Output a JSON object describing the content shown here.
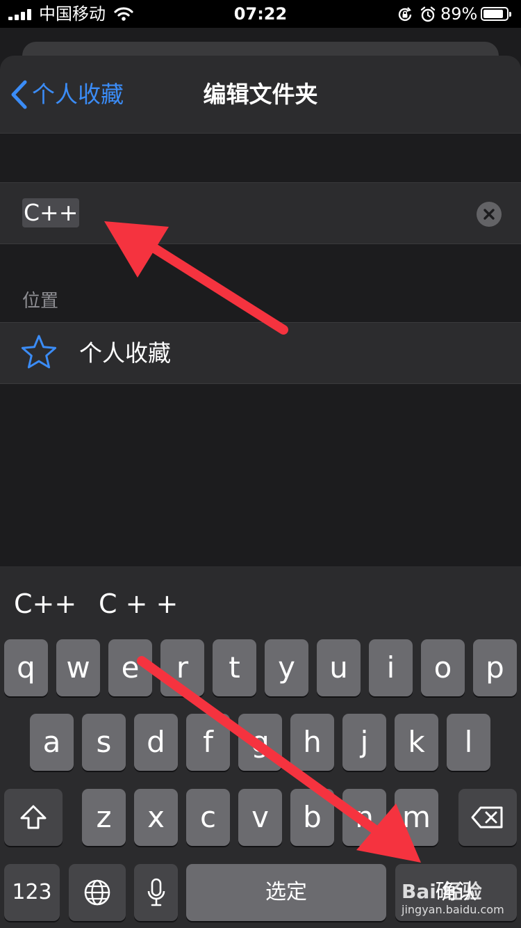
{
  "status_bar": {
    "carrier": "中国移动",
    "time": "07:22",
    "battery": "89%",
    "battery_level": 0.89
  },
  "nav": {
    "back_label": "个人收藏",
    "title": "编辑文件夹"
  },
  "form": {
    "folder_name": "C++"
  },
  "location": {
    "section_header": "位置",
    "item_label": "个人收藏"
  },
  "keyboard": {
    "suggestions": [
      "C++",
      "C + +"
    ],
    "row1": [
      "q",
      "w",
      "e",
      "r",
      "t",
      "y",
      "u",
      "i",
      "o",
      "p"
    ],
    "row2": [
      "a",
      "s",
      "d",
      "f",
      "g",
      "h",
      "j",
      "k",
      "l"
    ],
    "row3": [
      "z",
      "x",
      "c",
      "v",
      "b",
      "n",
      "m"
    ],
    "numbers_key": "123",
    "space_key": "选定",
    "confirm_key": "确认"
  },
  "watermark": {
    "logo": "Bai 经验",
    "url": "jingyan.baidu.com"
  },
  "colors": {
    "accent": "#3b8cf6",
    "annotation_arrow": "#f5333f",
    "background": "#1c1c1e",
    "row_background": "#2c2c2e",
    "key": "#6b6b6f"
  }
}
